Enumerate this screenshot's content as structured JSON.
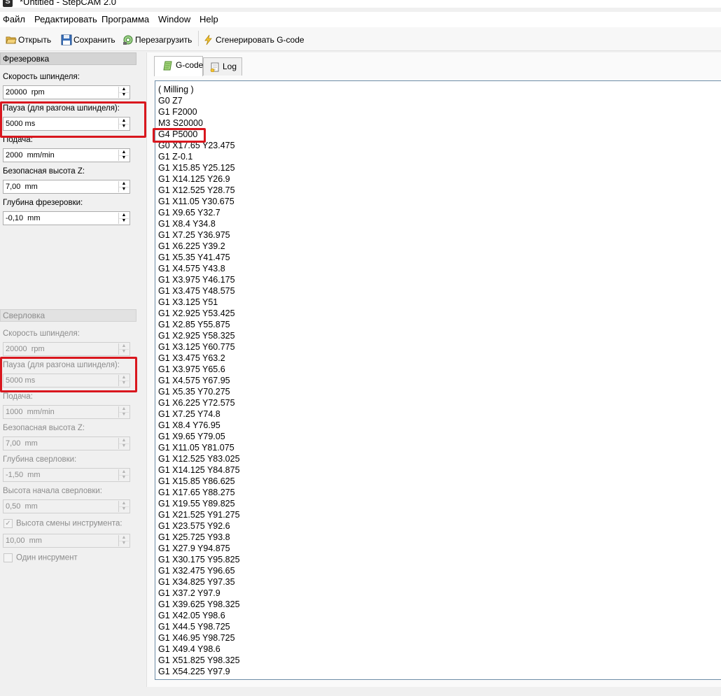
{
  "window": {
    "title": "*Untitled - StepCAM 2.0"
  },
  "menu": [
    "Файл",
    "Редактировать",
    "Программа",
    "Window",
    "Help"
  ],
  "toolbar": {
    "open": "Открыть",
    "save": "Сохранить",
    "reload": "Перезагрузить",
    "generate": "Сгенерировать G-code"
  },
  "milling": {
    "header": "Фрезеровка",
    "fields": [
      {
        "label": "Скорость шпинделя:",
        "value": "20000  rpm"
      },
      {
        "label": "Пауза (для разгона шпинделя):",
        "value": "5000 ms"
      },
      {
        "label": "Подача:",
        "value": "2000  mm/min"
      },
      {
        "label": "Безопасная высота Z:",
        "value": "7,00  mm"
      },
      {
        "label": "Глубина фрезеровки:",
        "value": "-0,10  mm"
      }
    ]
  },
  "drilling": {
    "header": "Сверловка",
    "fields": [
      {
        "label": "Скорость шпинделя:",
        "value": "20000  rpm"
      },
      {
        "label": "Пауза (для разгона шпинделя):",
        "value": "5000 ms"
      },
      {
        "label": "Подача:",
        "value": "1000  mm/min"
      },
      {
        "label": "Безопасная высота Z:",
        "value": "7,00  mm"
      },
      {
        "label": "Глубина сверловки:",
        "value": "-1,50  mm"
      },
      {
        "label": "Высота начала сверловки:",
        "value": "0,50  mm"
      }
    ],
    "tool_change_checkbox": {
      "label": "Высота смены инструмента:",
      "checked": true,
      "value": "10,00  mm"
    },
    "single_tool_checkbox": {
      "label": "Один инсрумент",
      "checked": false
    }
  },
  "tabs": [
    {
      "label": "G-code",
      "icon": "gcode-scroll-icon",
      "active": true
    },
    {
      "label": "Log",
      "icon": "log-doc-icon",
      "active": false
    }
  ],
  "gcode_lines": [
    "( Milling )",
    "G0 Z7",
    "G1 F2000",
    "M3 S20000",
    "G4 P5000",
    "G0 X17.65 Y23.475",
    "G1 Z-0.1",
    "G1 X15.85 Y25.125",
    "G1 X14.125 Y26.9",
    "G1 X12.525 Y28.75",
    "G1 X11.05 Y30.675",
    "G1 X9.65 Y32.7",
    "G1 X8.4 Y34.8",
    "G1 X7.25 Y36.975",
    "G1 X6.225 Y39.2",
    "G1 X5.35 Y41.475",
    "G1 X4.575 Y43.8",
    "G1 X3.975 Y46.175",
    "G1 X3.475 Y48.575",
    "G1 X3.125 Y51",
    "G1 X2.925 Y53.425",
    "G1 X2.85 Y55.875",
    "G1 X2.925 Y58.325",
    "G1 X3.125 Y60.775",
    "G1 X3.475 Y63.2",
    "G1 X3.975 Y65.6",
    "G1 X4.575 Y67.95",
    "G1 X5.35 Y70.275",
    "G1 X6.225 Y72.575",
    "G1 X7.25 Y74.8",
    "G1 X8.4 Y76.95",
    "G1 X9.65 Y79.05",
    "G1 X11.05 Y81.075",
    "G1 X12.525 Y83.025",
    "G1 X14.125 Y84.875",
    "G1 X15.85 Y86.625",
    "G1 X17.65 Y88.275",
    "G1 X19.55 Y89.825",
    "G1 X21.525 Y91.275",
    "G1 X23.575 Y92.6",
    "G1 X25.725 Y93.8",
    "G1 X27.9 Y94.875",
    "G1 X30.175 Y95.825",
    "G1 X32.475 Y96.65",
    "G1 X34.825 Y97.35",
    "G1 X37.2 Y97.9",
    "G1 X39.625 Y98.325",
    "G1 X42.05 Y98.6",
    "G1 X44.5 Y98.725",
    "G1 X46.95 Y98.725",
    "G1 X49.4 Y98.6",
    "G1 X51.825 Y98.325",
    "G1 X54.225 Y97.9"
  ],
  "colors": {
    "highlight": "#d9171e",
    "editor_border": "#6f8ea8"
  }
}
